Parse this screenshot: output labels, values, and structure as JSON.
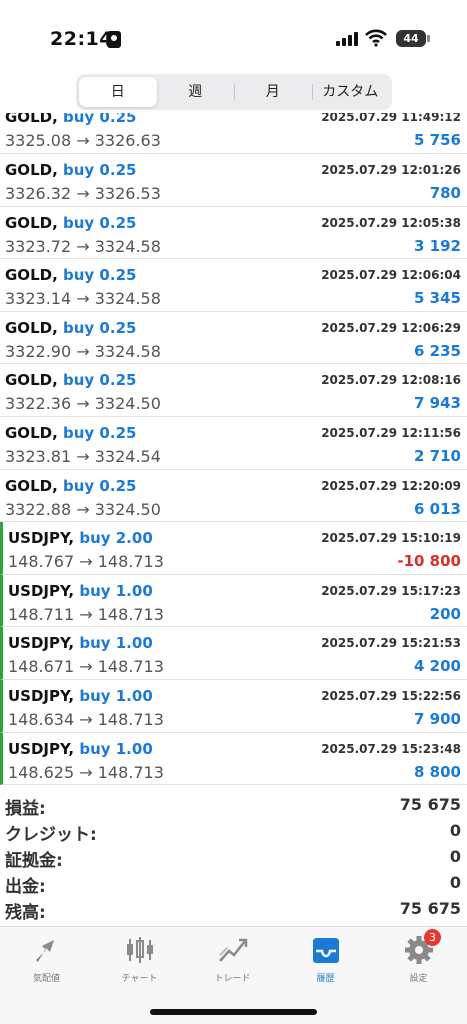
{
  "status": {
    "time": "22:14",
    "battery": "44"
  },
  "segments": [
    "日",
    "週",
    "月",
    "カスタム"
  ],
  "rows": [
    {
      "symbol": "GOLD,",
      "dir": "buy 0.25",
      "time": "2025.07.29 11:49:12",
      "prices": "3325.08 → 3326.63",
      "pl": "5 756",
      "neg": false,
      "jpy": false
    },
    {
      "symbol": "GOLD,",
      "dir": "buy 0.25",
      "time": "2025.07.29 12:01:26",
      "prices": "3326.32 → 3326.53",
      "pl": "780",
      "neg": false,
      "jpy": false
    },
    {
      "symbol": "GOLD,",
      "dir": "buy 0.25",
      "time": "2025.07.29 12:05:38",
      "prices": "3323.72 → 3324.58",
      "pl": "3 192",
      "neg": false,
      "jpy": false
    },
    {
      "symbol": "GOLD,",
      "dir": "buy 0.25",
      "time": "2025.07.29 12:06:04",
      "prices": "3323.14 → 3324.58",
      "pl": "5 345",
      "neg": false,
      "jpy": false
    },
    {
      "symbol": "GOLD,",
      "dir": "buy 0.25",
      "time": "2025.07.29 12:06:29",
      "prices": "3322.90 → 3324.58",
      "pl": "6 235",
      "neg": false,
      "jpy": false
    },
    {
      "symbol": "GOLD,",
      "dir": "buy 0.25",
      "time": "2025.07.29 12:08:16",
      "prices": "3322.36 → 3324.50",
      "pl": "7 943",
      "neg": false,
      "jpy": false
    },
    {
      "symbol": "GOLD,",
      "dir": "buy 0.25",
      "time": "2025.07.29 12:11:56",
      "prices": "3323.81 → 3324.54",
      "pl": "2 710",
      "neg": false,
      "jpy": false
    },
    {
      "symbol": "GOLD,",
      "dir": "buy 0.25",
      "time": "2025.07.29 12:20:09",
      "prices": "3322.88 → 3324.50",
      "pl": "6 013",
      "neg": false,
      "jpy": false
    },
    {
      "symbol": "USDJPY,",
      "dir": "buy 2.00",
      "time": "2025.07.29 15:10:19",
      "prices": "148.767 → 148.713",
      "pl": "-10 800",
      "neg": true,
      "jpy": true
    },
    {
      "symbol": "USDJPY,",
      "dir": "buy 1.00",
      "time": "2025.07.29 15:17:23",
      "prices": "148.711 → 148.713",
      "pl": "200",
      "neg": false,
      "jpy": true
    },
    {
      "symbol": "USDJPY,",
      "dir": "buy 1.00",
      "time": "2025.07.29 15:21:53",
      "prices": "148.671 → 148.713",
      "pl": "4 200",
      "neg": false,
      "jpy": true
    },
    {
      "symbol": "USDJPY,",
      "dir": "buy 1.00",
      "time": "2025.07.29 15:22:56",
      "prices": "148.634 → 148.713",
      "pl": "7 900",
      "neg": false,
      "jpy": true
    },
    {
      "symbol": "USDJPY,",
      "dir": "buy 1.00",
      "time": "2025.07.29 15:23:48",
      "prices": "148.625 → 148.713",
      "pl": "8 800",
      "neg": false,
      "jpy": true
    }
  ],
  "summary": [
    {
      "label": "損益:",
      "value": "75 675"
    },
    {
      "label": "クレジット:",
      "value": "0"
    },
    {
      "label": "証拠金:",
      "value": "0"
    },
    {
      "label": "出金:",
      "value": "0"
    },
    {
      "label": "残高:",
      "value": "75 675"
    }
  ],
  "tabs": [
    {
      "label": "気配値",
      "icon": "quotes-icon"
    },
    {
      "label": "チャート",
      "icon": "chart-candles-icon"
    },
    {
      "label": "トレード",
      "icon": "trade-icon"
    },
    {
      "label": "履歴",
      "icon": "history-inbox-icon"
    },
    {
      "label": "設定",
      "icon": "gear-icon"
    }
  ],
  "settings_badge": "3",
  "colors": {
    "accent": "#1a7bd6",
    "negative": "#d9302a",
    "jpy_marker": "#2fa43a"
  }
}
